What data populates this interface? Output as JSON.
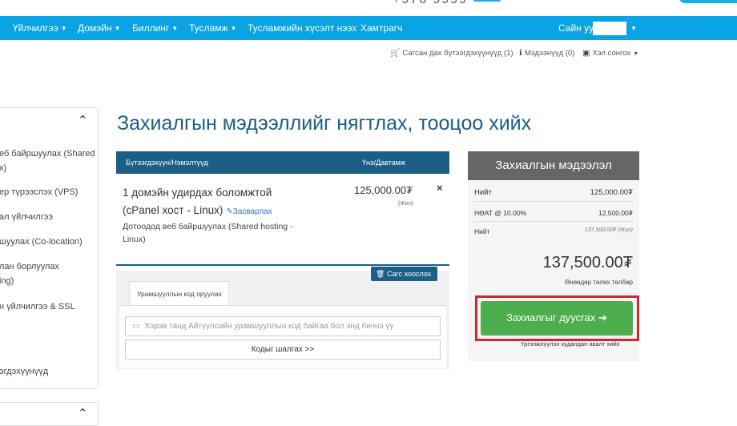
{
  "top": {
    "phone": "+976 9999"
  },
  "nav": {
    "items": [
      {
        "label": "Үйлчилгээ",
        "caret": true
      },
      {
        "label": "Домэйн",
        "caret": true
      },
      {
        "label": "Биллинг",
        "caret": true
      },
      {
        "label": "Тусламж",
        "caret": true
      },
      {
        "label": "Тусламжийн хүсэлт нээх",
        "caret": false
      },
      {
        "label": "Хамтрагч",
        "caret": false
      }
    ],
    "user_greeting": "Сайн уу,"
  },
  "subbar": {
    "cart": "Сагсан дах бүтээгдэхүүнүүд (1)",
    "notifications": "Мэдээнүүд (0)",
    "language": "Хэл сонгох"
  },
  "sidebar": {
    "items": [
      "еб байршуулах (Shared",
      "х)",
      "ер түрээслэх (VPS)",
      "ал үйлчилгээ",
      "шуулах (Co-location)",
      "лан борлуулах",
      "ing)",
      "н үйлчилгээ & SSL",
      "эгдэхүүнүүд"
    ]
  },
  "page": {
    "title": "Захиалгын мэдээллийг нягтлах, тооцоо хийх"
  },
  "cart": {
    "col_product": "Бүтээгдэхүүн/Нэмэлтүүд",
    "col_price": "Үнэ/Давтамж",
    "product_name": "1 домэйн удирдах боломжтой (cPanel хост - Linux)",
    "edit_label": "Засварлах",
    "product_group": "Дотоодод веб байршуулах (Shared hosting - Linux)",
    "price": "125,000.00₮",
    "cycle": "(Жил)",
    "remove": "×",
    "empty_cart": "Сагс хоослох"
  },
  "promo": {
    "tab_label": "Урамшууллын код оруулах",
    "placeholder": "Хэрэв танд Айтүүлсийн урамшууллын код байгаа бол энд бичнэ үү",
    "validate_label": "Кодыг шалгах >>"
  },
  "summary": {
    "header": "Захиалгын мэдээлэл",
    "subtotal_label": "Нийт",
    "subtotal": "125,000.00₮",
    "tax_label": "НӨАТ @ 10.00%",
    "tax": "12,500.00₮",
    "recurring_label": "Нийт",
    "recurring": "137,500.00₮ (Жил)",
    "total": "137,500.00₮",
    "total_due_label": "Өнөөдөр төлөх төлбөр",
    "checkout_label": "Захиалгыг дуусгах",
    "continue_label": "Үргэлжлүүлэн худалдан авалт хийх"
  },
  "colors": {
    "nav_blue": "#0aa3e3",
    "brand_dark": "#1b5e86",
    "checkout_green": "#4cae4c",
    "highlight_red": "#d9232d"
  }
}
